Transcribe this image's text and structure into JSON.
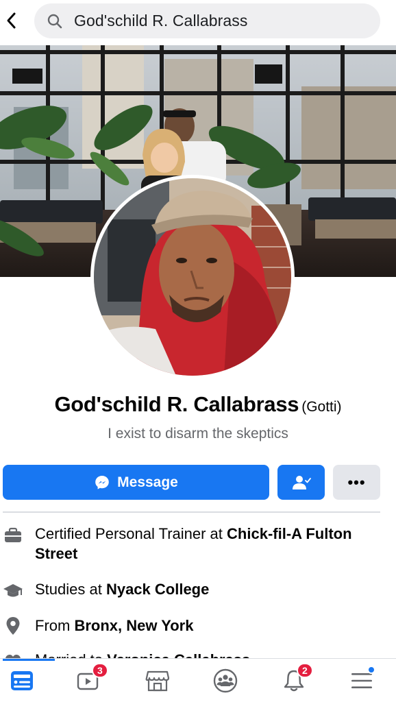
{
  "search": {
    "query": "God'schild R. Callabrass"
  },
  "profile": {
    "name": "God'schild R. Callabrass",
    "nickname": "(Gotti)",
    "bio": "I exist to disarm the skeptics"
  },
  "actions": {
    "message_label": "Message",
    "more_label": "•••"
  },
  "intro": [
    {
      "icon": "briefcase-icon",
      "prefix": "Certified Personal Trainer at ",
      "bold": "Chick-fil-A Fulton Street"
    },
    {
      "icon": "graduation-cap-icon",
      "prefix": "Studies at ",
      "bold": "Nyack College"
    },
    {
      "icon": "location-pin-icon",
      "prefix": "From ",
      "bold": "Bronx, New York"
    },
    {
      "icon": "heart-icon",
      "prefix": "Married to ",
      "bold": "Veronica Callabrass"
    }
  ],
  "tabbar": {
    "tabs": [
      {
        "name": "home",
        "icon": "news-feed-icon",
        "active": true
      },
      {
        "name": "watch",
        "icon": "video-icon",
        "badge": "3"
      },
      {
        "name": "marketplace",
        "icon": "shop-icon"
      },
      {
        "name": "groups",
        "icon": "groups-icon"
      },
      {
        "name": "notifications",
        "icon": "bell-icon",
        "badge": "2"
      },
      {
        "name": "menu",
        "icon": "hamburger-menu-icon",
        "dot": true
      }
    ]
  },
  "colors": {
    "brand_blue": "#1877f2",
    "badge_red": "#e41e3f",
    "secondary_text": "#65676b",
    "button_gray": "#e4e6eb"
  }
}
